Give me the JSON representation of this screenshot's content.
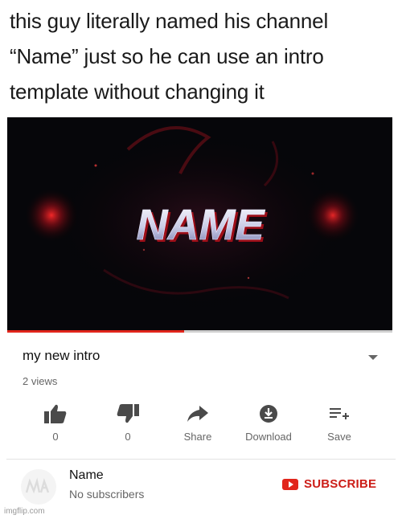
{
  "caption": {
    "line1": "this guy literally named his channel",
    "line2": "“Name” just so he can use an intro",
    "line3": "template without changing it"
  },
  "video": {
    "logo_text": "NAME",
    "progress_fraction": 0.46,
    "title": "my new intro",
    "views": "2 views"
  },
  "actions": {
    "like_count": "0",
    "dislike_count": "0",
    "share_label": "Share",
    "download_label": "Download",
    "save_label": "Save"
  },
  "channel": {
    "name": "Name",
    "subscribers": "No subscribers",
    "subscribe_label": "SUBSCRIBE"
  },
  "watermark": "imgflip.com",
  "colors": {
    "accent_red": "#e1251b",
    "text_gray": "#666666"
  }
}
